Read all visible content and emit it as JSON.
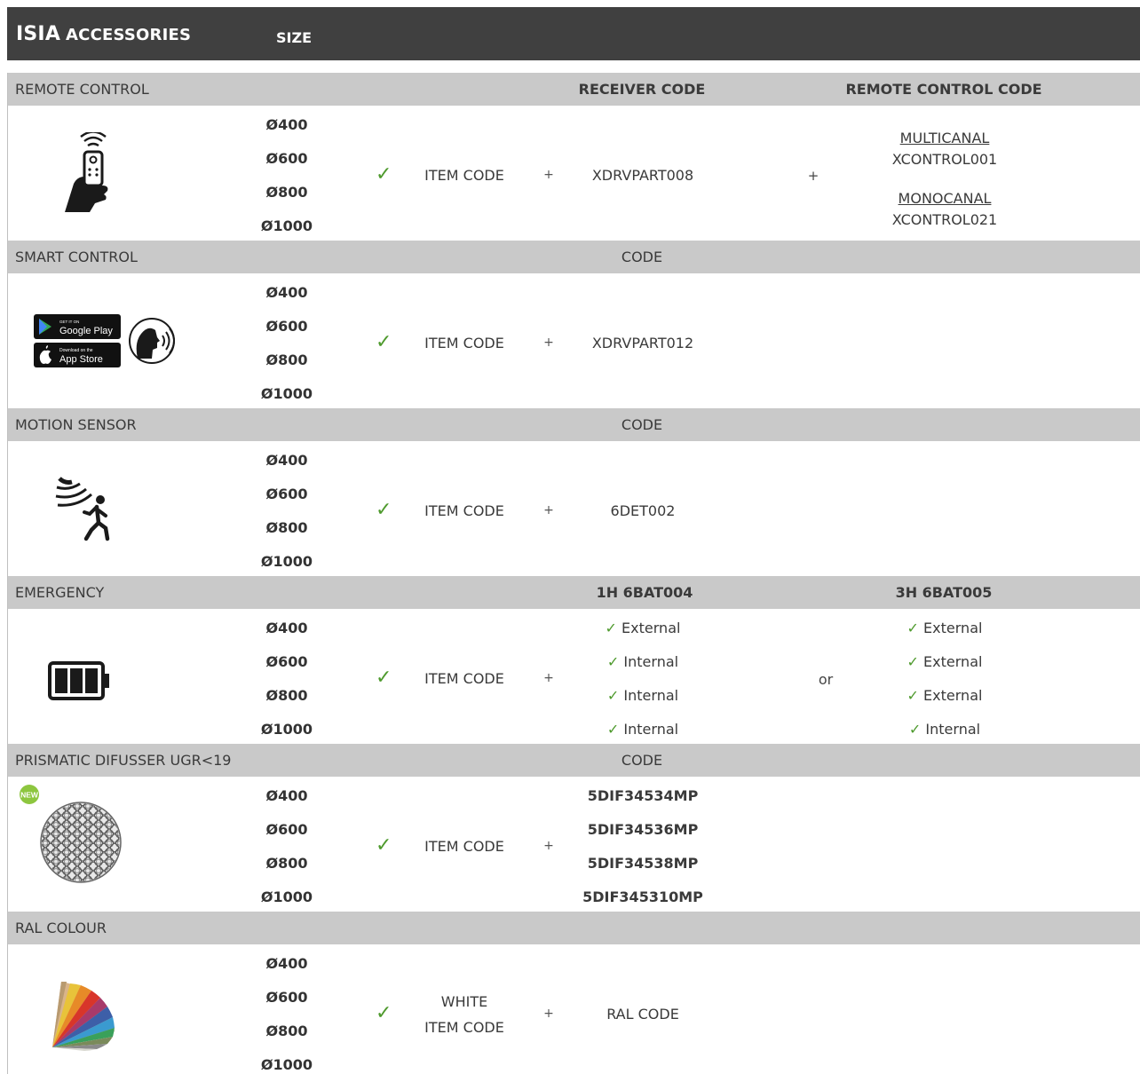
{
  "header": {
    "brand": "ISIA",
    "subtitle": "ACCESSORIES",
    "size_label": "SIZE"
  },
  "sizes": [
    "Ø400",
    "Ø600",
    "Ø800",
    "Ø1000"
  ],
  "check_mark": "✓",
  "plus_sign": "+",
  "sections": {
    "remote": {
      "label": "REMOTE CONTROL",
      "col3_header": "RECEIVER CODE",
      "col5_header": "REMOTE CONTROL CODE",
      "item_code": "ITEM CODE",
      "receiver": "XDRVPART008",
      "multi_label": "MULTICANAL",
      "multi_code": "XCONTROL001",
      "mono_label": "MONOCANAL",
      "mono_code": "XCONTROL021"
    },
    "smart": {
      "label": "SMART CONTROL",
      "col3_header": "CODE",
      "item_code": "ITEM CODE",
      "code": "XDRVPART012",
      "google_small": "GET IT ON",
      "google_big": "Google Play",
      "apple_small": "Download on the",
      "apple_big": "App Store"
    },
    "motion": {
      "label": "MOTION SENSOR",
      "col3_header": "CODE",
      "item_code": "ITEM CODE",
      "code": "6DET002"
    },
    "emergency": {
      "label": "EMERGENCY",
      "col3_header": "1H  6BAT004",
      "col5_header": "3H  6BAT005",
      "item_code": "ITEM CODE",
      "or": "or",
      "bat_1h": [
        "External",
        "Internal",
        "Internal",
        "Internal"
      ],
      "bat_3h": [
        "External",
        "External",
        "External",
        "Internal"
      ]
    },
    "prismatic": {
      "label": "PRISMATIC DIFUSSER  UGR<19",
      "col3_header": "CODE",
      "item_code": "ITEM CODE",
      "new_badge": "NEW",
      "codes": [
        "5DIF34534MP",
        "5DIF34536MP",
        "5DIF34538MP",
        "5DIF345310MP"
      ]
    },
    "ral": {
      "label": "RAL COLOUR",
      "item_line1": "WHITE",
      "item_line2": "ITEM CODE",
      "code": "RAL CODE"
    }
  },
  "colors": {
    "header_bg": "#404040",
    "band_bg": "#c9c9c9",
    "check_green": "#4e9a2d",
    "new_badge": "#8dc63f"
  }
}
